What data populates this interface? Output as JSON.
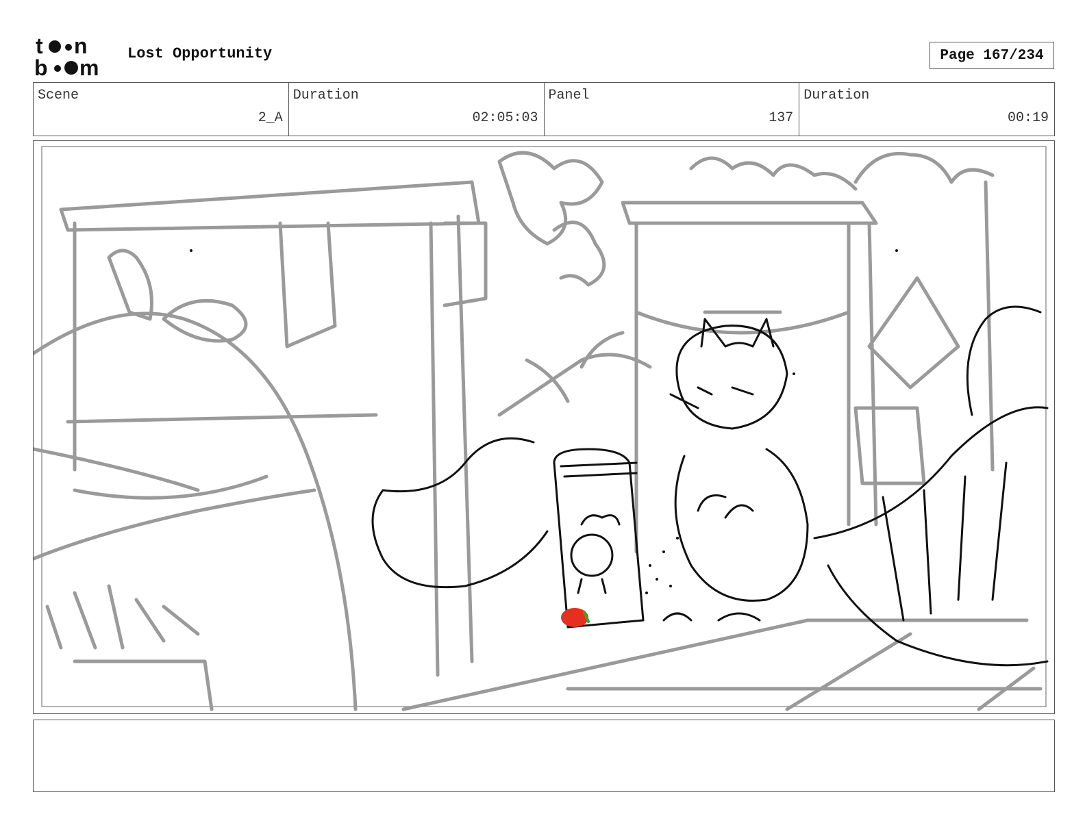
{
  "header": {
    "logo_text_top": "toon",
    "logo_text_bottom": "boom",
    "title": "Lost Opportunity",
    "page": "Page 167/234"
  },
  "info": {
    "scene_label": "Scene",
    "scene_value": "2_A",
    "scene_duration_label": "Duration",
    "scene_duration_value": "02:05:03",
    "panel_label": "Panel",
    "panel_value": "137",
    "panel_duration_label": "Duration",
    "panel_duration_value": "00:19"
  },
  "colors": {
    "sketch_gray": "#9a9a9a",
    "sketch_black": "#111111",
    "accent_red": "#e53020",
    "accent_green": "#2aa838"
  },
  "notes": {
    "text": ""
  }
}
